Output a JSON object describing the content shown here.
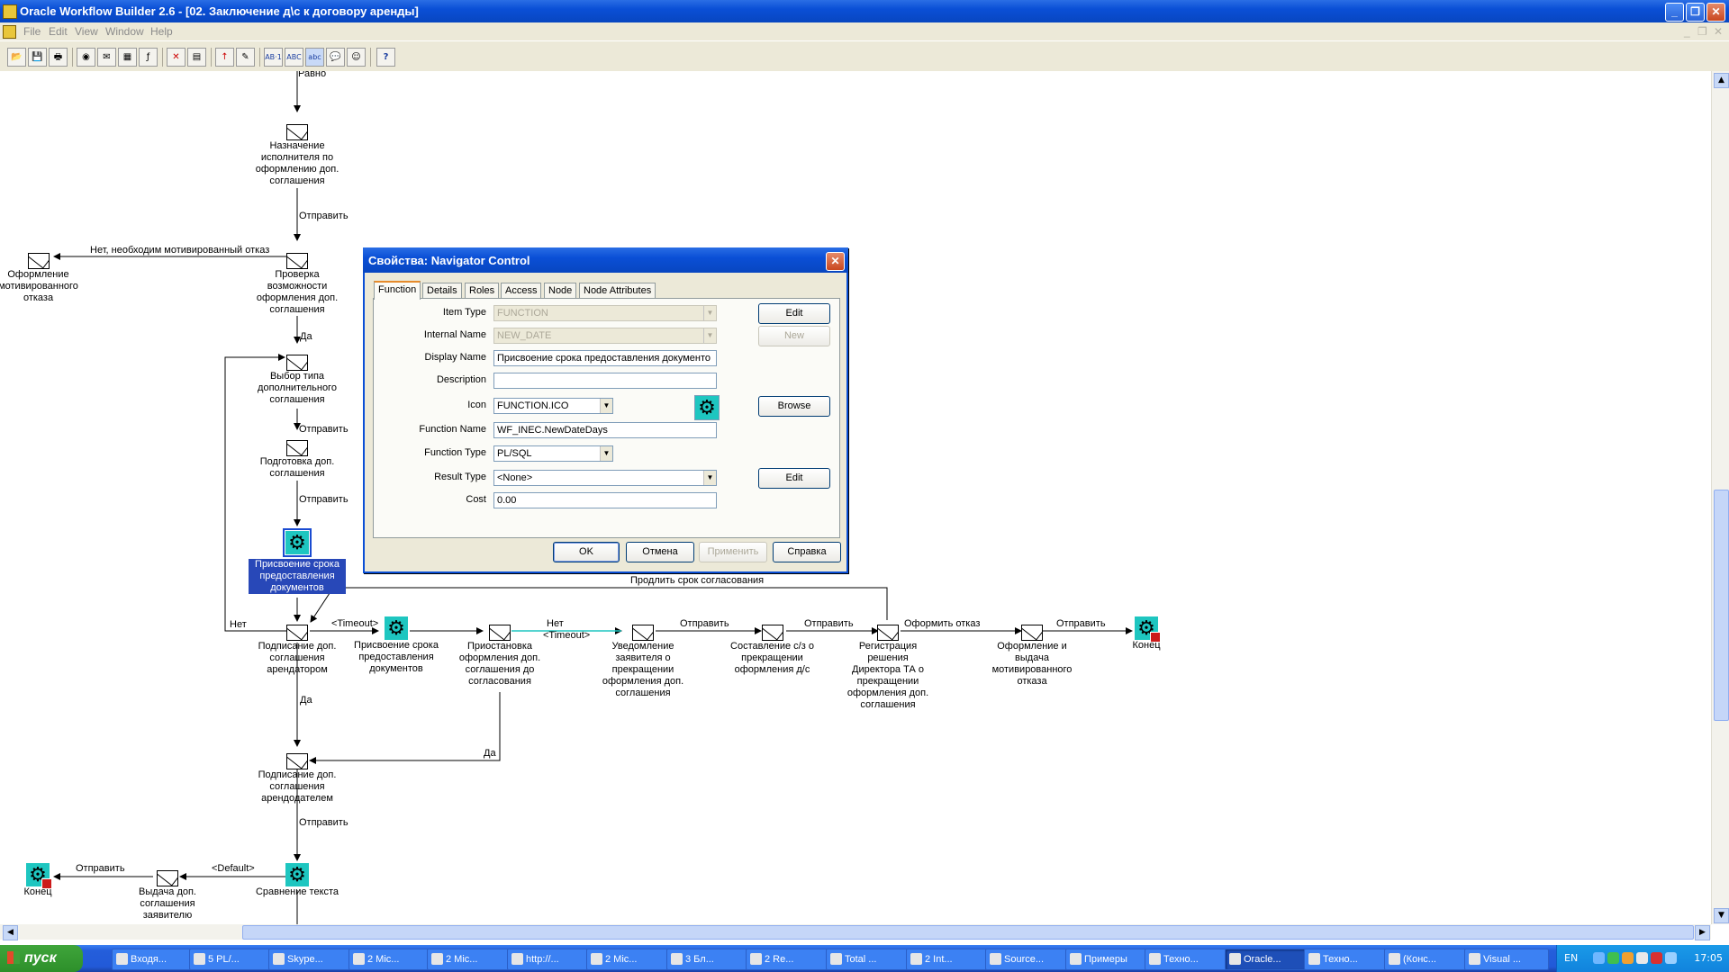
{
  "window": {
    "title": "Oracle Workflow Builder 2.6 - [02. Заключение д\\с к договору аренды]",
    "controls": {
      "minimize": "_",
      "restore": "❐",
      "close": "✕"
    }
  },
  "menu": {
    "items": [
      "File",
      "Edit",
      "View",
      "Window",
      "Help"
    ],
    "mdi": {
      "minimize": "_",
      "restore": "❐",
      "close": "✕"
    }
  },
  "toolbar": {
    "icons": [
      "open-icon",
      "save-icon",
      "print-icon",
      "find-icon",
      "message-icon",
      "lookup-icon",
      "function-icon",
      "delete-icon",
      "properties-icon",
      "arrow-icon",
      "edit-icon",
      "ab1-icon",
      "abc-icon",
      "abc-sel-icon",
      "comment-icon",
      "smiley-icon",
      "help-icon"
    ],
    "labels": {
      "ab1": "AB·1",
      "abc1": "ABC",
      "abc2": "abc",
      "help": "?"
    }
  },
  "diagram": {
    "nodes": {
      "n_ravno": "Равно",
      "n_assign": [
        "Назначение",
        "исполнителя по",
        "оформлению доп.",
        "соглашения"
      ],
      "n_check": [
        "Проверка",
        "возможности",
        "оформления доп.",
        "соглашения"
      ],
      "n_refusal": [
        "Оформление",
        "мотивированного",
        "отказа"
      ],
      "n_choose": [
        "Выбор типа",
        "дополнительного",
        "соглашения"
      ],
      "n_prep": [
        "Подготовка доп.",
        "соглашения"
      ],
      "n_assign_sel": [
        "Присвоение срока",
        "предоставления",
        "документов"
      ],
      "n_sign_tenant": [
        "Подписание доп.",
        "соглашения",
        "арендатором"
      ],
      "n_assign2": [
        "Присвоение срока",
        "предоставления",
        "документов"
      ],
      "n_suspend": [
        "Приостановка",
        "оформления доп.",
        "соглашения до",
        "согласования"
      ],
      "n_notify": [
        "Уведомление",
        "заявителя о",
        "прекращении",
        "оформления доп.",
        "соглашения"
      ],
      "n_compose": [
        "Составление с/з о",
        "прекращении",
        "оформления д/с"
      ],
      "n_register": [
        "Регистрация",
        "решения",
        "Директора ТА о",
        "прекращении",
        "оформления доп.",
        "соглашения"
      ],
      "n_issue_refusal": [
        "Оформление и",
        "выдача",
        "мотивированного",
        "отказа"
      ],
      "n_end1": "Конец",
      "n_sign_landlord": [
        "Подписание доп.",
        "соглашения",
        "арендодателем"
      ],
      "n_compare": "Сравнение текста",
      "n_issue": [
        "Выдача доп.",
        "соглашения",
        "заявителю"
      ],
      "n_end2": "Конец"
    },
    "edges": {
      "send": "Отправить",
      "no_reason": "Нет, необходим мотивированный отказ",
      "yes": "Да",
      "no": "Нет",
      "timeout": "<Timeout>",
      "extend": "Продлить срок согласования",
      "refuse": "Оформить отказ",
      "default": "<Default>"
    }
  },
  "dialog": {
    "title": "Свойства: Navigator Control",
    "close": "✕",
    "tabs": [
      "Function",
      "Details",
      "Roles",
      "Access",
      "Node",
      "Node Attributes"
    ],
    "active_tab": "Function",
    "fields": {
      "item_type": {
        "label": "Item Type",
        "value": "FUNCTION"
      },
      "internal_name": {
        "label": "Internal Name",
        "value": "NEW_DATE"
      },
      "display_name": {
        "label": "Display Name",
        "value": "Присвоение срока предоставления документо"
      },
      "description": {
        "label": "Description",
        "value": ""
      },
      "icon": {
        "label": "Icon",
        "value": "FUNCTION.ICO"
      },
      "function_name": {
        "label": "Function Name",
        "value": "WF_INEC.NewDateDays"
      },
      "function_type": {
        "label": "Function Type",
        "value": "PL/SQL"
      },
      "result_type": {
        "label": "Result Type",
        "value": "<None>"
      },
      "cost": {
        "label": "Cost",
        "value": "0.00"
      }
    },
    "side_buttons": {
      "edit1": "Edit",
      "new": "New",
      "browse": "Browse",
      "edit2": "Edit"
    },
    "buttons": {
      "ok": "OK",
      "cancel": "Отмена",
      "apply": "Применить",
      "help": "Справка"
    },
    "dropdown_arrow": "▼"
  },
  "scroll": {
    "up": "▲",
    "down": "▼",
    "left": "◀",
    "right": "▶"
  },
  "taskbar": {
    "start": "пуск",
    "items": [
      "Входя...",
      "5 PL/...",
      "Skype...",
      "2 Mic...",
      "2 Mic...",
      "http://...",
      "2 Mic...",
      "3 Бл...",
      "2 Re...",
      "Total ...",
      "2 Int...",
      "Source...",
      "Примеры",
      "Техно...",
      "Oracle...",
      "Техно...",
      "(Конс...",
      "Visual ..."
    ],
    "active_index": 14,
    "lang": "EN",
    "clock": "17:05"
  },
  "colors": {
    "accent": "#0a4fd6",
    "function_node": "#1ec6c0",
    "selection": "#2848b8"
  }
}
